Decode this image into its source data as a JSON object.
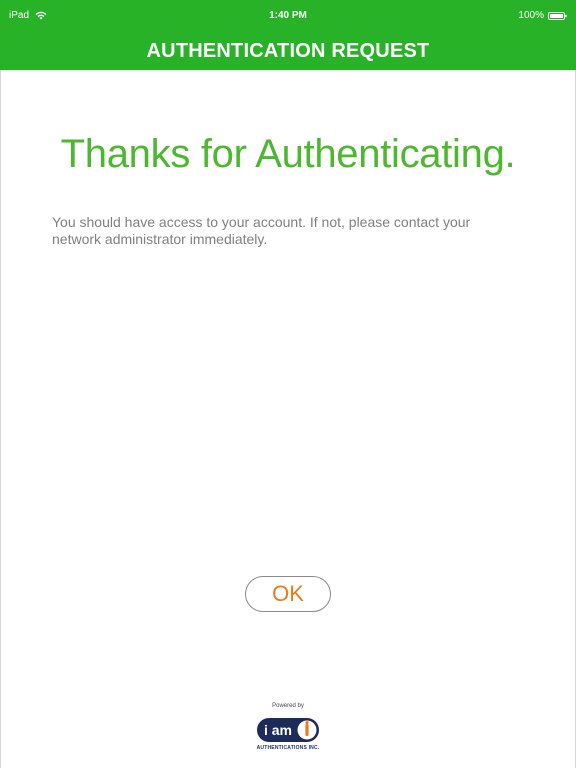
{
  "status_bar": {
    "device": "iPad",
    "time": "1:40 PM",
    "battery": "100%",
    "wifi_icon": "wifi-icon",
    "battery_icon": "battery-icon"
  },
  "nav": {
    "title": "AUTHENTICATION REQUEST"
  },
  "main": {
    "headline": "Thanks for Authenticating.",
    "message": "You should have access to your account. If not, please contact your network administrator immediately.",
    "ok_label": "OK"
  },
  "footer": {
    "powered_by": "Powered by",
    "logo_text": "i am",
    "company": "AUTHENTICATIONS INC."
  },
  "colors": {
    "header_green": "#27b227",
    "headline_green": "#4cb830",
    "ok_orange": "#ee7a1a",
    "text_gray": "#808080",
    "logo_navy": "#1c2b57"
  }
}
